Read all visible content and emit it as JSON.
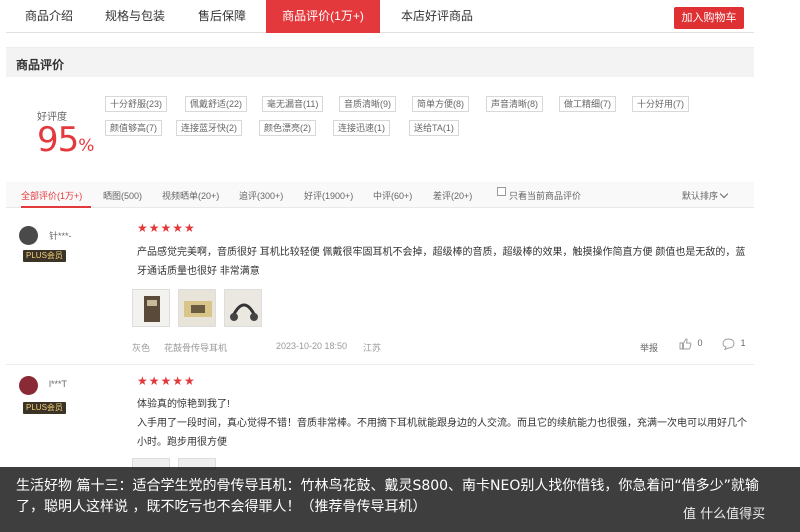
{
  "tabs": [
    {
      "label": "商品介绍",
      "active": false
    },
    {
      "label": "规格与包装",
      "active": false
    },
    {
      "label": "售后保障",
      "active": false
    },
    {
      "label": "商品评价(1万+)",
      "active": true
    },
    {
      "label": "本店好评商品",
      "active": false
    }
  ],
  "cart_button": "加入购物车",
  "section_title": "商品评价",
  "rating": {
    "label": "好评度",
    "value": "95",
    "unit": "%"
  },
  "tags": [
    "十分舒服(23)",
    "佩戴舒适(22)",
    "毫无漏音(11)",
    "音质清晰(9)",
    "简单方便(8)",
    "声音清晰(8)",
    "做工精细(7)",
    "十分好用(7)",
    "颜值够高(7)",
    "连接蓝牙快(2)",
    "颜色漂亮(2)",
    "连接迅速(1)",
    "送给TA(1)"
  ],
  "filters": [
    "全部评价(1万+)",
    "晒图(500)",
    "视频晒单(20+)",
    "追评(300+)",
    "好评(1900+)",
    "中评(60+)",
    "差评(20+)"
  ],
  "only_current": "只看当前商品评价",
  "sort": "默认排序",
  "reviews": [
    {
      "user": "针***-",
      "badge": "PLUS会员",
      "stars": "★★★★★",
      "text": "产品感觉完美啊，音质很好 耳机比较轻便 佩戴很牢固耳机不会掉，超级棒的音质，超级棒的效果，触摸操作简直方便 颜值也是无敌的，蓝牙通话质量也很好 非常满意",
      "color": "灰色",
      "product": "花鼓骨传导耳机",
      "time": "2023-10-20 18:50",
      "location": "江苏",
      "report": "举报",
      "likes": "0",
      "comments": "1"
    },
    {
      "user": "l***T",
      "badge": "PLUS会员",
      "stars": "★★★★★",
      "text1": "体验真的惊艳到我了!",
      "text2": "入手用了一段时间，真心觉得不错！音质非常棒。不用摘下耳机就能跟身边的人交流。而且它的续航能力也很强，充满一次电可以用好几个小时。跑步用很方便"
    }
  ],
  "caption": "生活好物 篇十三：适合学生党的骨传导耳机：竹林鸟花鼓、戴灵S800、南卡NEO别人找你借钱，你急着问“借多少”就输了，聪明人这样说 ，既不吃亏也不会得罪人！（推荐骨传导耳机）",
  "watermark": "值 什么值得买",
  "colors": {
    "accent": "#e4393c",
    "plus_bg": "#3a3326",
    "plus_text": "#f5d07a"
  }
}
